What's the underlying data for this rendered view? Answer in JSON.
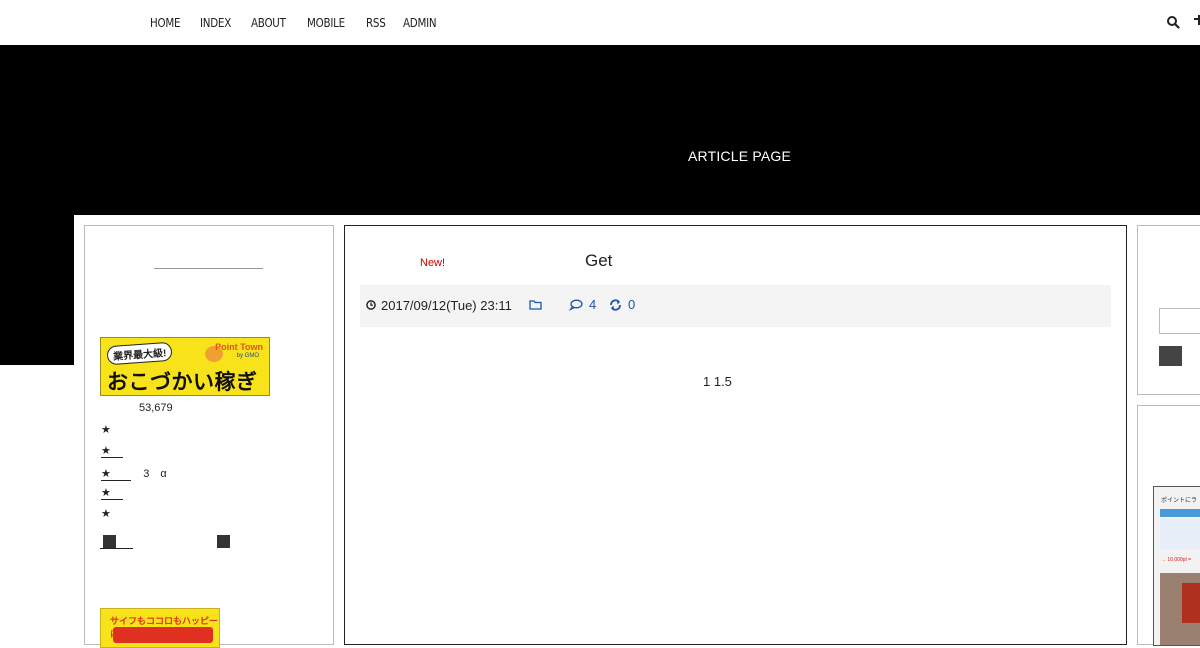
{
  "nav": {
    "items": [
      {
        "label": "HOME"
      },
      {
        "label": "INDEX"
      },
      {
        "label": "ABOUT"
      },
      {
        "label": "MOBILE"
      },
      {
        "label": "RSS"
      },
      {
        "label": "ADMIN"
      }
    ],
    "icons": [
      "search-icon",
      "menu-icon"
    ]
  },
  "header": {
    "title": "ARTICLE PAGE"
  },
  "left_sidebar": {
    "banner1": {
      "tagline": "業界最大級!",
      "brand": "Point Town",
      "brand_sub": "by GMO",
      "headline": "おこづかい稼ぎ"
    },
    "count": "53,679",
    "lines": [
      "★",
      "★",
      "★",
      "3　α",
      "★",
      "★"
    ],
    "banner2": {
      "tagline": "サイフもココロもハッピーに!"
    }
  },
  "article": {
    "badge": "New!",
    "title": "Get",
    "date": "2017/09/12(Tue) 23:11",
    "comment_count": "4",
    "trackback_count": "0",
    "body": "1  1.5"
  },
  "right_sidebar": {
    "image_caption": "ポイントにラ",
    "image_note": "→ 10,000pt ="
  },
  "colors": {
    "hero_bg": "#000000",
    "accent_link": "#1a56b0",
    "new_badge": "#cc0000",
    "banner_yellow": "#f8e21a"
  }
}
